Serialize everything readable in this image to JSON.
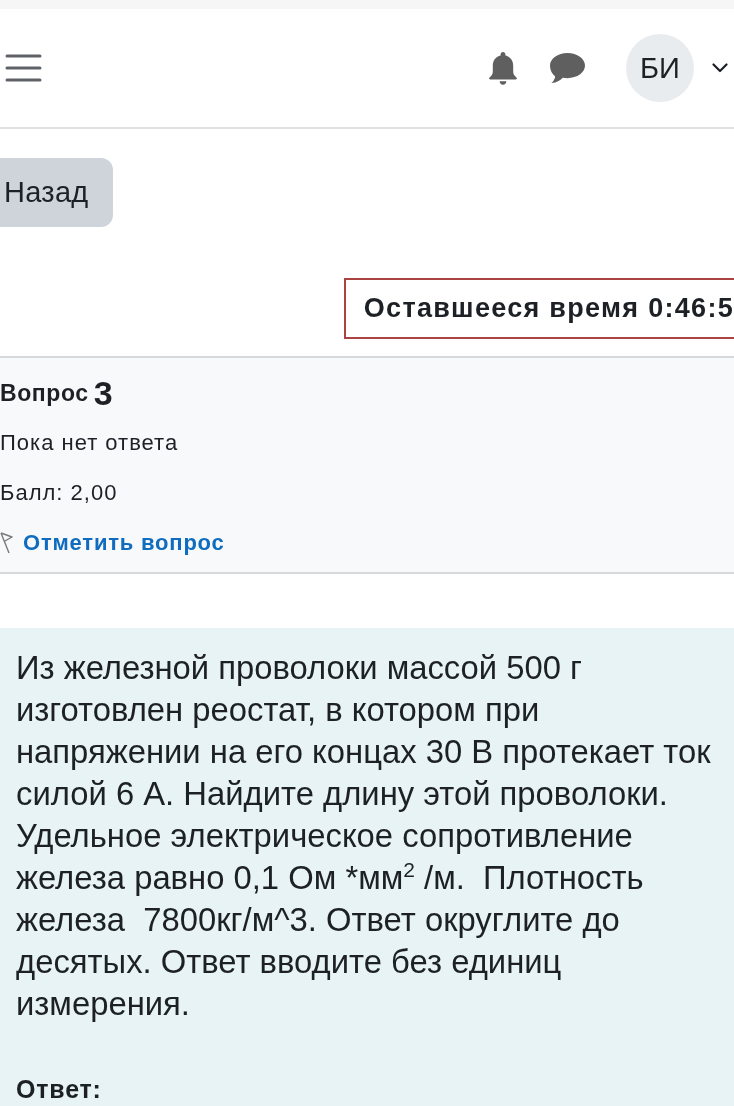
{
  "header": {
    "avatar": {
      "initials": "БИ"
    }
  },
  "back_button": {
    "label": "Назад"
  },
  "timer": {
    "text": "Оставшееся время 0:46:5"
  },
  "question_info": {
    "title": "Вопрос",
    "number": "3",
    "status": "Пока нет ответа",
    "mark": "Балл: 2,00",
    "flag_link": "Отметить вопрос"
  },
  "question": {
    "text": "Из железной проволоки массой 500 г изготовлен реостат, в котором при напряжении на его концах 30 В протекает ток силой 6 А. Найдите длину этой проволоки. Удельное электрическое сопротивление железа равно 0,1 Ом *мм$^{2}$ /м.  Плотность железа  7800кг/м^3. Ответ округлите до десятых. Ответ вводите без единиц измерения.",
    "answer_label": "Ответ:"
  }
}
